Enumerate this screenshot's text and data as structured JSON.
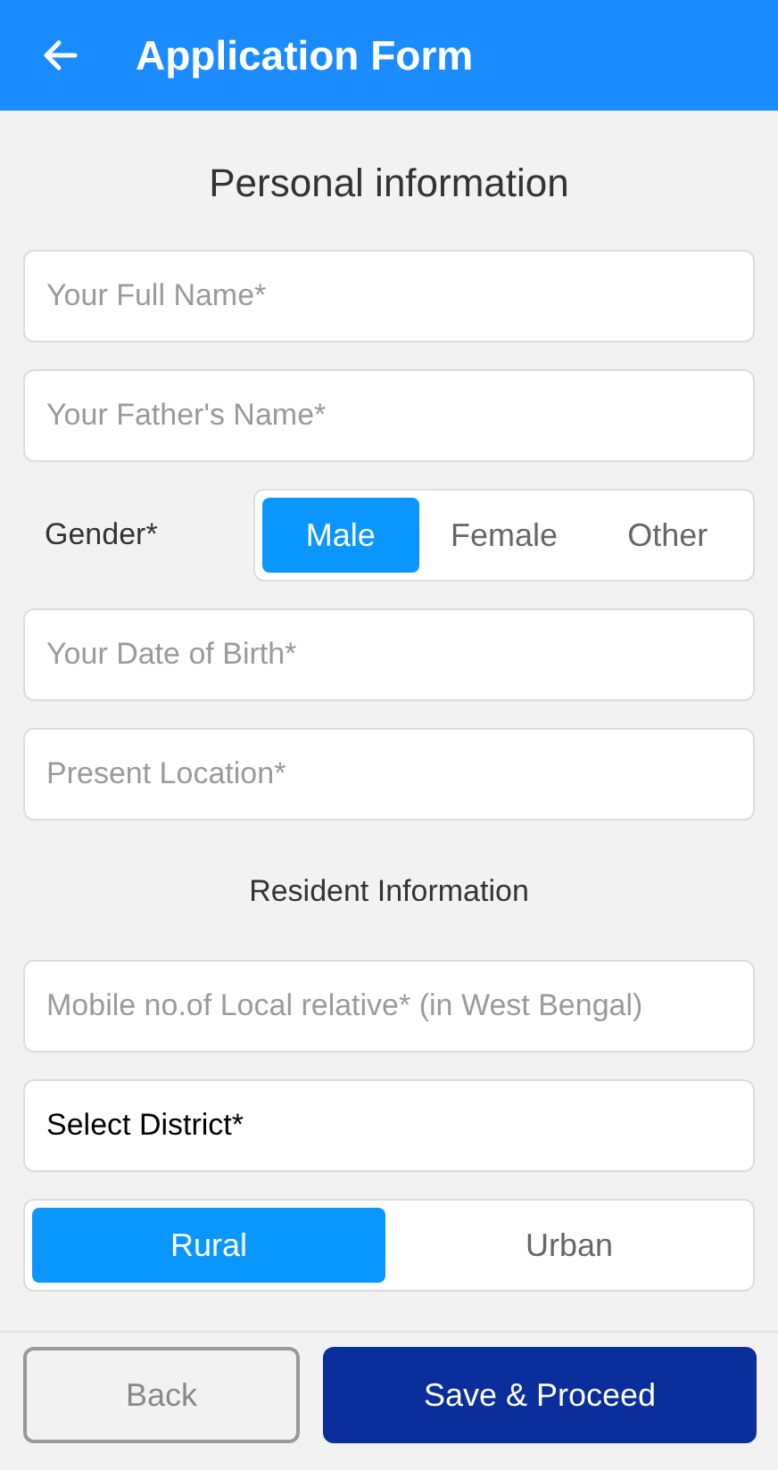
{
  "header": {
    "title": "Application Form"
  },
  "sections": [
    {
      "heading": "Personal information",
      "kind": "large",
      "fields": [
        {
          "kind": "input",
          "placeholder": "Your Full Name*"
        },
        {
          "kind": "input",
          "placeholder": "Your Father's Name*"
        },
        {
          "kind": "segmented",
          "label": "Gender*",
          "options": [
            {
              "label": "Male",
              "selected": true
            },
            {
              "label": "Female",
              "selected": false
            },
            {
              "label": "Other",
              "selected": false
            }
          ]
        },
        {
          "kind": "input",
          "placeholder": "Your Date of Birth*"
        },
        {
          "kind": "input",
          "placeholder": "Present Location*"
        }
      ]
    },
    {
      "heading": "Resident Information",
      "kind": "small",
      "fields": [
        {
          "kind": "input",
          "placeholder": "Mobile no.of Local relative* (in West Bengal)"
        },
        {
          "kind": "select",
          "value": "Select District*"
        },
        {
          "kind": "segmented",
          "options": [
            {
              "label": "Rural",
              "selected": true
            },
            {
              "label": "Urban",
              "selected": false
            }
          ]
        }
      ]
    }
  ],
  "buttons": [
    {
      "label": "Back",
      "kind": "secondary"
    },
    {
      "label": "Save & Proceed",
      "kind": "primary"
    }
  ]
}
